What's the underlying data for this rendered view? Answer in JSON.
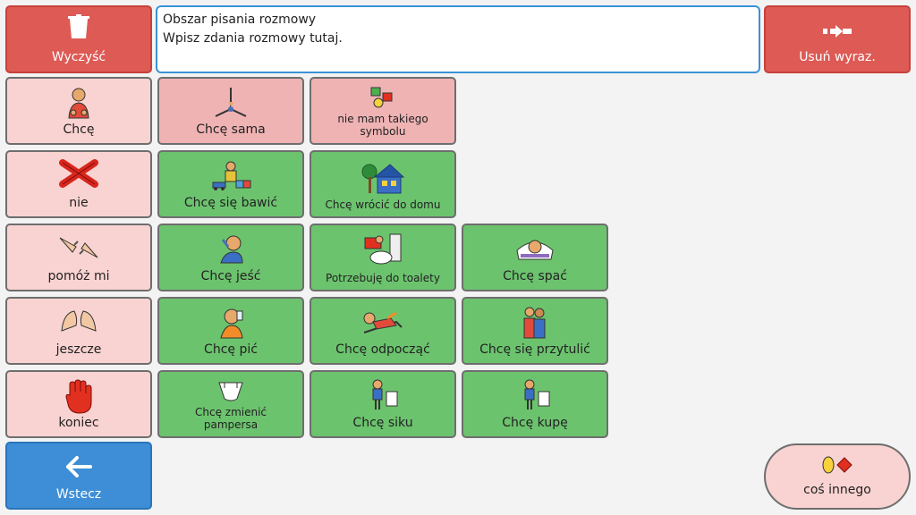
{
  "toolbar": {
    "clear_label": "Wyczyść",
    "delete_word_label": "Usuń wyraz."
  },
  "message_area": {
    "line1": "Obszar pisania rozmowy",
    "line2": "Wpisz zdania rozmowy tutaj."
  },
  "core": {
    "want": "Chcę",
    "no": "nie",
    "help": "pomóż mi",
    "more": "jeszcze",
    "stop": "koniec",
    "back": "Wstecz"
  },
  "phrases": {
    "want_alone": "Chcę sama",
    "no_symbol_line1": "nie mam takiego",
    "no_symbol_line2": "symbolu",
    "play": "Chcę się bawić",
    "go_home": "Chcę wrócić do domu",
    "eat": "Chcę jeść",
    "toilet": "Potrzebuję do toalety",
    "sleep": "Chcę spać",
    "drink": "Chcę pić",
    "rest": "Chcę odpocząć",
    "hug": "Chcę się przytulić",
    "diaper_line1": "Chcę zmienić",
    "diaper_line2": "pampersa",
    "pee": "Chcę siku",
    "poop": "Chcę kupę"
  },
  "something_else": "coś innego",
  "colors": {
    "red_button": "#dd5a55",
    "pink_cell": "#f9d3d1",
    "green_cell": "#6cc36e",
    "blue_button": "#3d8ed6",
    "textarea_border": "#3a92d6"
  }
}
